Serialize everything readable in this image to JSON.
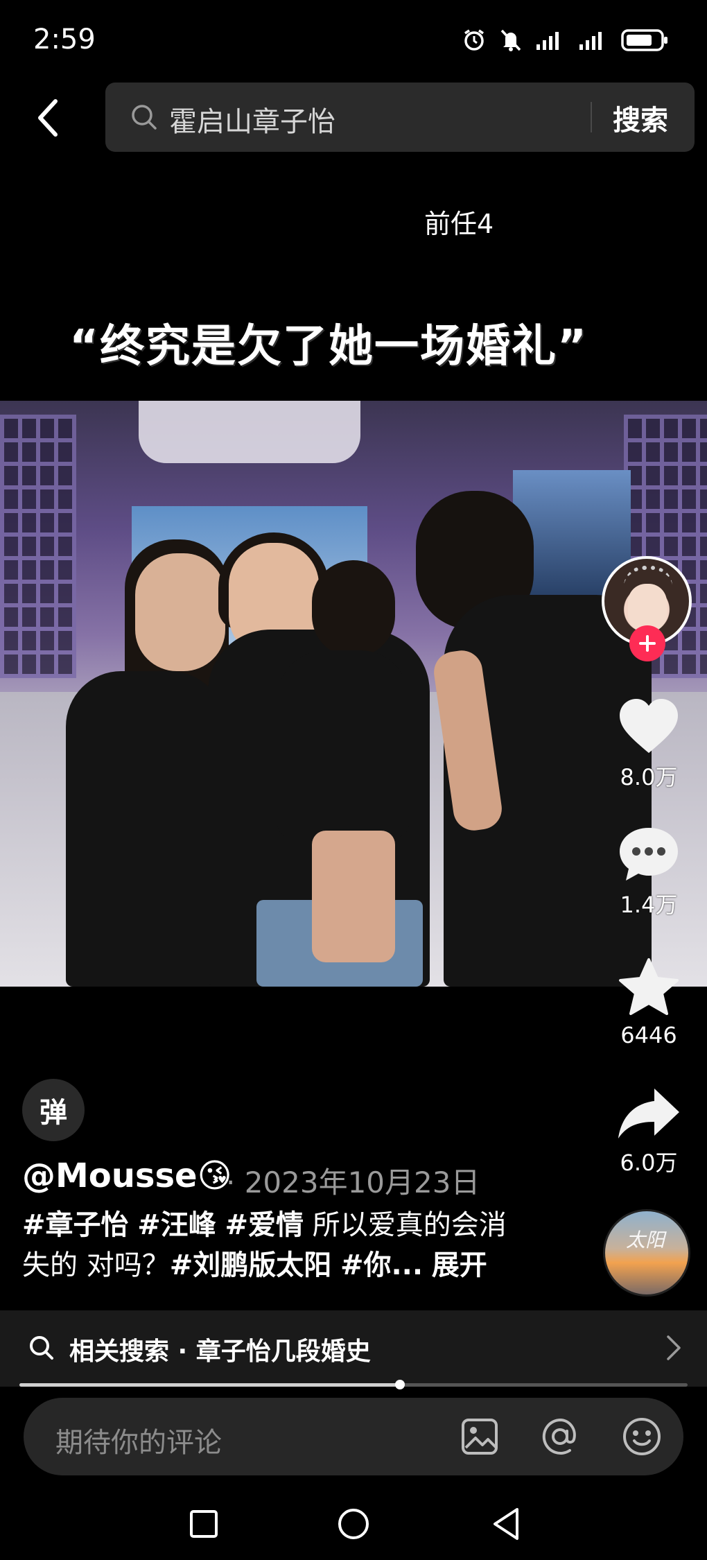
{
  "status_bar": {
    "time": "2:59",
    "icons": [
      "alarm-icon",
      "mute-icon",
      "signal-icon",
      "signal-icon",
      "battery-icon"
    ]
  },
  "header": {
    "search_query": "霍启山章子怡",
    "search_button": "搜索"
  },
  "video": {
    "caption_small": "前任4",
    "caption_big": "“终究是欠了她一场婚礼”"
  },
  "actions": {
    "likes": "8.0万",
    "comments": "1.4万",
    "favorites": "6446",
    "shares": "6.0万"
  },
  "danmaku_label": "弹",
  "author": "@Mousse😘",
  "date": "· 2023年10月23日",
  "description": {
    "tags1": [
      "#章子怡",
      "#汪峰",
      "#爱情"
    ],
    "text1": "所以爱真的会消",
    "text2": "失的 对吗？",
    "tags2": [
      "#刘鹏版太阳",
      "#你..."
    ],
    "expand": "展开"
  },
  "related_search": "相关搜索 · 章子怡几段婚史",
  "progress": 0.57,
  "comment_placeholder": "期待你的评论",
  "music_disc_text": "太阳",
  "colors": {
    "background": "#000000",
    "accent": "#fe2c55",
    "search_bg": "#2b2b2b"
  }
}
